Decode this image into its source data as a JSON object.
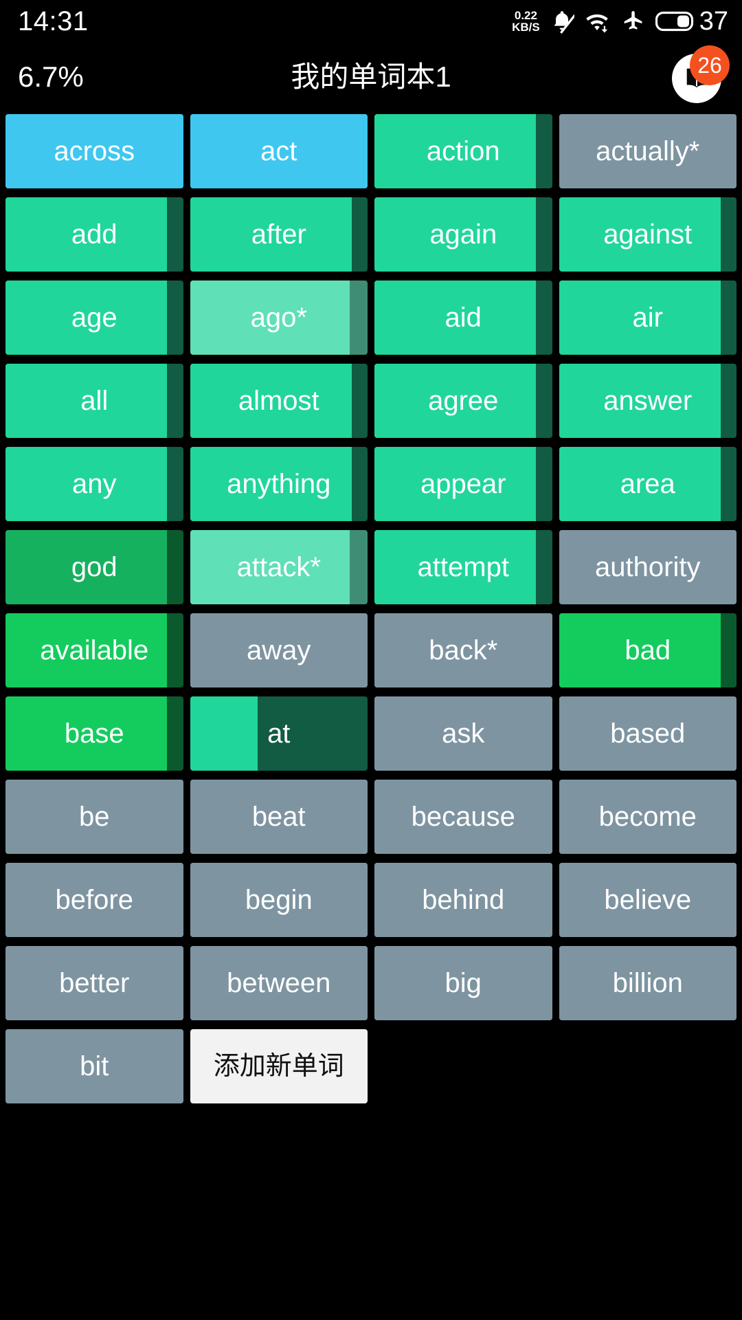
{
  "status_bar": {
    "clock": "14:31",
    "net_speed_value": "0.22",
    "net_speed_unit": "KB/S",
    "icons": [
      "bell-muted-icon",
      "wifi-icon",
      "airplane-mode-icon",
      "battery-icon"
    ],
    "battery_level": "37"
  },
  "title_bar": {
    "progress_percent": "6.7%",
    "deck_title": "我的单词本1",
    "book_icon": "open-book-icon",
    "book_badge_count": "26"
  },
  "colors": {
    "background": "#000000",
    "blue": "#3FC7F0",
    "green": "#21D69B",
    "green_light": "#5FE0B6",
    "green_bright": "#14CC5E",
    "green_dark": "#16B15F",
    "track_dark": "#115C43",
    "gray": "#7E94A1",
    "badge_orange": "#F4511E",
    "add_button_bg": "#F2F2F2",
    "tile_text": "#FFFFFF"
  },
  "add_button": {
    "label": "添加新单词"
  },
  "grid": {
    "columns": 4,
    "tiles": [
      {
        "word": "across",
        "fill": "#3FC7F0",
        "track": "#3FC7F0",
        "fill_pct": 100
      },
      {
        "word": "act",
        "fill": "#3FC7F0",
        "track": "#3FC7F0",
        "fill_pct": 100
      },
      {
        "word": "action",
        "fill": "#21D69B",
        "track": "#115C43",
        "fill_pct": 91
      },
      {
        "word": "actually*",
        "fill": "#7E94A1",
        "track": "#7E94A1",
        "fill_pct": 100
      },
      {
        "word": "add",
        "fill": "#21D69B",
        "track": "#115C43",
        "fill_pct": 91
      },
      {
        "word": "after",
        "fill": "#21D69B",
        "track": "#115C43",
        "fill_pct": 91
      },
      {
        "word": "again",
        "fill": "#21D69B",
        "track": "#115C43",
        "fill_pct": 91
      },
      {
        "word": "against",
        "fill": "#21D69B",
        "track": "#115C43",
        "fill_pct": 91
      },
      {
        "word": "age",
        "fill": "#21D69B",
        "track": "#115C43",
        "fill_pct": 91
      },
      {
        "word": "ago*",
        "fill": "#5FE0B6",
        "track": "#3F8D74",
        "fill_pct": 90
      },
      {
        "word": "aid",
        "fill": "#21D69B",
        "track": "#115C43",
        "fill_pct": 91
      },
      {
        "word": "air",
        "fill": "#21D69B",
        "track": "#115C43",
        "fill_pct": 91
      },
      {
        "word": "all",
        "fill": "#21D69B",
        "track": "#115C43",
        "fill_pct": 91
      },
      {
        "word": "almost",
        "fill": "#21D69B",
        "track": "#115C43",
        "fill_pct": 91
      },
      {
        "word": "agree",
        "fill": "#21D69B",
        "track": "#115C43",
        "fill_pct": 91
      },
      {
        "word": "answer",
        "fill": "#21D69B",
        "track": "#115C43",
        "fill_pct": 91
      },
      {
        "word": "any",
        "fill": "#21D69B",
        "track": "#115C43",
        "fill_pct": 91
      },
      {
        "word": "anything",
        "fill": "#21D69B",
        "track": "#115C43",
        "fill_pct": 91
      },
      {
        "word": "appear",
        "fill": "#21D69B",
        "track": "#115C43",
        "fill_pct": 91
      },
      {
        "word": "area",
        "fill": "#21D69B",
        "track": "#115C43",
        "fill_pct": 91
      },
      {
        "word": "god",
        "fill": "#16B15F",
        "track": "#0B5A2E",
        "fill_pct": 91
      },
      {
        "word": "attack*",
        "fill": "#5FE0B6",
        "track": "#3F8D74",
        "fill_pct": 90
      },
      {
        "word": "attempt",
        "fill": "#21D69B",
        "track": "#115C43",
        "fill_pct": 91
      },
      {
        "word": "authority",
        "fill": "#7E94A1",
        "track": "#7E94A1",
        "fill_pct": 100
      },
      {
        "word": "available",
        "fill": "#14CC5E",
        "track": "#0B5A2E",
        "fill_pct": 91
      },
      {
        "word": "away",
        "fill": "#7E94A1",
        "track": "#7E94A1",
        "fill_pct": 100
      },
      {
        "word": "back*",
        "fill": "#7E94A1",
        "track": "#7E94A1",
        "fill_pct": 100
      },
      {
        "word": "bad",
        "fill": "#14CC5E",
        "track": "#0B5A2E",
        "fill_pct": 91
      },
      {
        "word": "base",
        "fill": "#14CC5E",
        "track": "#0B5A2E",
        "fill_pct": 91
      },
      {
        "word": "at",
        "fill": "#21D69B",
        "track": "#115C43",
        "fill_pct": 38
      },
      {
        "word": "ask",
        "fill": "#7E94A1",
        "track": "#7E94A1",
        "fill_pct": 100
      },
      {
        "word": "based",
        "fill": "#7E94A1",
        "track": "#7E94A1",
        "fill_pct": 100
      },
      {
        "word": "be",
        "fill": "#7E94A1",
        "track": "#7E94A1",
        "fill_pct": 100
      },
      {
        "word": "beat",
        "fill": "#7E94A1",
        "track": "#7E94A1",
        "fill_pct": 100
      },
      {
        "word": "because",
        "fill": "#7E94A1",
        "track": "#7E94A1",
        "fill_pct": 100
      },
      {
        "word": "become",
        "fill": "#7E94A1",
        "track": "#7E94A1",
        "fill_pct": 100
      },
      {
        "word": "before",
        "fill": "#7E94A1",
        "track": "#7E94A1",
        "fill_pct": 100
      },
      {
        "word": "begin",
        "fill": "#7E94A1",
        "track": "#7E94A1",
        "fill_pct": 100
      },
      {
        "word": "behind",
        "fill": "#7E94A1",
        "track": "#7E94A1",
        "fill_pct": 100
      },
      {
        "word": "believe",
        "fill": "#7E94A1",
        "track": "#7E94A1",
        "fill_pct": 100
      },
      {
        "word": "better",
        "fill": "#7E94A1",
        "track": "#7E94A1",
        "fill_pct": 100
      },
      {
        "word": "between",
        "fill": "#7E94A1",
        "track": "#7E94A1",
        "fill_pct": 100
      },
      {
        "word": "big",
        "fill": "#7E94A1",
        "track": "#7E94A1",
        "fill_pct": 100
      },
      {
        "word": "billion",
        "fill": "#7E94A1",
        "track": "#7E94A1",
        "fill_pct": 100
      },
      {
        "word": "bit",
        "fill": "#7E94A1",
        "track": "#7E94A1",
        "fill_pct": 100
      }
    ]
  }
}
